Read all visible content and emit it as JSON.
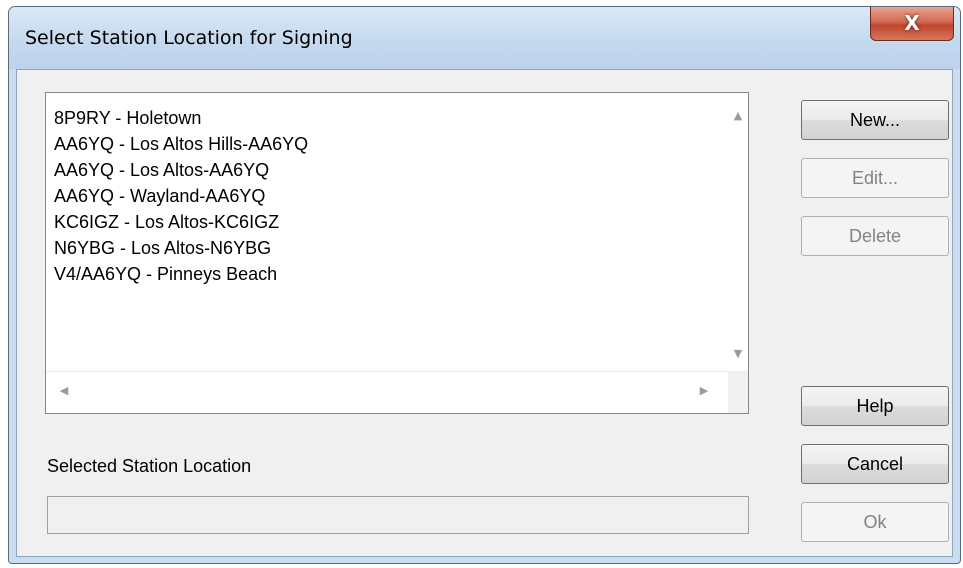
{
  "window": {
    "title": "Select Station Location for Signing",
    "close_label": "X"
  },
  "station_list": {
    "items": [
      "8P9RY - Holetown",
      "AA6YQ - Los Altos Hills-AA6YQ",
      "AA6YQ - Los Altos-AA6YQ",
      "AA6YQ - Wayland-AA6YQ",
      "KC6IGZ - Los Altos-KC6IGZ",
      "N6YBG - Los Altos-N6YBG",
      "V4/AA6YQ - Pinneys Beach"
    ],
    "scroll_up_icon": "▲",
    "scroll_down_icon": "▼",
    "scroll_left_icon": "◀",
    "scroll_right_icon": "▶"
  },
  "buttons": {
    "new_label": "New...",
    "edit_label": "Edit...",
    "delete_label": "Delete",
    "help_label": "Help",
    "cancel_label": "Cancel",
    "ok_label": "Ok"
  },
  "selected": {
    "label": "Selected Station Location",
    "value": ""
  },
  "colors": {
    "frame": "#c9dcf0",
    "client": "#f0f0f0",
    "close_button": "#c7503a",
    "disabled_text": "#838383"
  }
}
